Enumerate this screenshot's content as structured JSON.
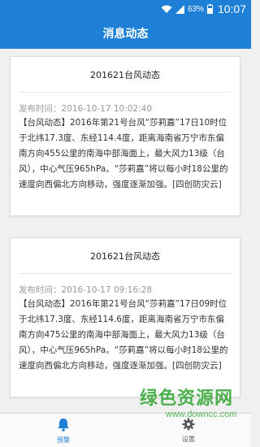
{
  "status_bar": {
    "battery_percent": "63%",
    "time": "10:07",
    "icons": [
      "wifi-icon",
      "signal-icon",
      "battery-icon"
    ]
  },
  "app_bar": {
    "title": "消息动态"
  },
  "messages": [
    {
      "title": "201621台风动态",
      "time": "发布时间：2016-10-17 10:02:40",
      "body": "【台风动态】2016年第21号台风“莎莉嘉”17日10时位于北纬17.3度、东经114.4度，距离海南省万宁市东偏南方向455公里的南海中部海面上，最大风力13级（台风），中心气压965hPa。“莎莉嘉”将以每小时18公里的速度向西偏北方向移动，强度逐渐加强。[四创防灾云]"
    },
    {
      "title": "201621台风动态",
      "time": "发布时间：2016-10-17 09:16:28",
      "body": "【台风动态】2016年第21号台风“莎莉嘉”17日09时位于北纬17.3度、东经114.6度，距离海南省万宁市东偏南方向475公里的南海中部海面上，最大风力13级（台风），中心气压965hPa。“莎莉嘉”将以每小时18公里的速度向西偏北方向移动，强度逐渐加强。[四创防灾云]"
    }
  ],
  "bottom_nav": {
    "items": [
      {
        "label": "预警",
        "icon": "bell-icon",
        "active": true
      },
      {
        "label": "设置",
        "icon": "gear-icon",
        "active": false
      }
    ]
  },
  "watermark": {
    "main": "绿色资源网",
    "sub": "www.downcc.com"
  },
  "colors": {
    "primary": "#1d7fd6",
    "background": "#f0f0f0",
    "watermark": "#39a83a"
  }
}
